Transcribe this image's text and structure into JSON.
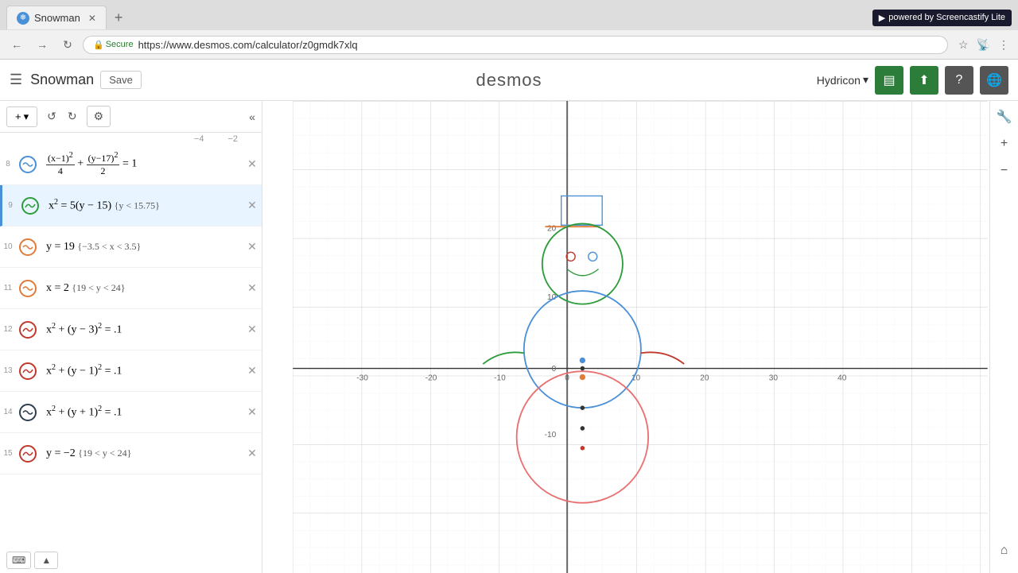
{
  "browser": {
    "tab_title": "Snowman",
    "url": "https://www.desmos.com/calculator/z0gmdk7xlq",
    "secure_label": "Secure",
    "screencastify": "powered by Screencastify Lite"
  },
  "header": {
    "menu_label": "☰",
    "project_name": "Snowman",
    "save_label": "Save",
    "logo": "desmos",
    "user_name": "Hydricon",
    "help_label": "?",
    "share_label": "⬆"
  },
  "toolbar": {
    "add_label": "+ ▾",
    "settings_label": "⚙",
    "collapse_label": "«"
  },
  "expressions": [
    {
      "num": "8",
      "color": "#4a90d9",
      "expr": "(x−1)²/4 + (y−17)²/2 = 1",
      "active": false
    },
    {
      "num": "9",
      "color": "#2d9c3c",
      "expr": "x² = 5(y − 15) {y < 15.75}",
      "active": true
    },
    {
      "num": "10",
      "color": "#e07b39",
      "expr": "y = 19 {−3.5 < x < 3.5}",
      "active": false
    },
    {
      "num": "11",
      "color": "#e07b39",
      "expr": "x = 2 {19 < y < 24}",
      "active": false
    },
    {
      "num": "12",
      "color": "#c0392b",
      "expr": "x² + (y − 3)² = .1",
      "active": false
    },
    {
      "num": "13",
      "color": "#c0392b",
      "expr": "x² + (y − 1)² = .1",
      "active": false
    },
    {
      "num": "14",
      "color": "#2c3e50",
      "expr": "x² + (y + 1)² = .1",
      "active": false
    },
    {
      "num": "15",
      "color": "#c0392b",
      "expr": "y = −2 {19 < y < 24}",
      "active": false
    }
  ],
  "graph": {
    "x_min": -30,
    "x_max": 40,
    "y_min": -15,
    "y_max": 25,
    "x_labels": [
      -30,
      -20,
      -10,
      0,
      10,
      20,
      30,
      40
    ],
    "y_labels": [
      -10,
      0,
      10,
      20
    ],
    "axis_labels_top": [
      -4,
      -2
    ]
  },
  "colors": {
    "blue_circle": "#4a90d9",
    "green": "#2d9c3c",
    "orange": "#e07b39",
    "red": "#c0392b",
    "dark": "#2c3e50",
    "light_red": "#e8a0a0"
  }
}
